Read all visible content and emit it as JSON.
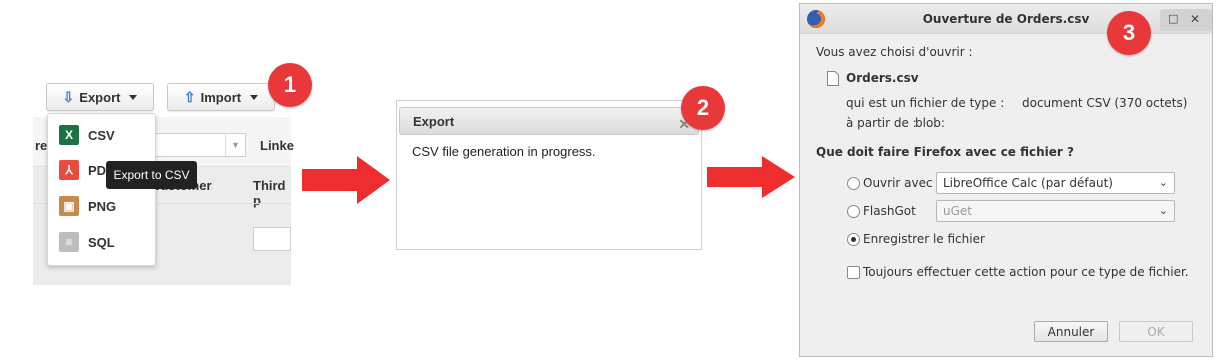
{
  "panel1": {
    "export_button": "Export",
    "import_button": "Import",
    "badge": "1",
    "bg_left_label": "re",
    "bg_linked_header": "Linke",
    "bg_customer_header": "customer",
    "bg_third_header": "Third p",
    "menu_items": [
      {
        "label": "CSV",
        "icon": "excel-icon",
        "color": "#1e7145",
        "glyph": "X"
      },
      {
        "label": "PD",
        "icon": "pdf-icon",
        "color": "#e74c3c",
        "glyph": "⅄"
      },
      {
        "label": "PNG",
        "icon": "image-icon",
        "color": "#c88a4a",
        "glyph": "▣"
      },
      {
        "label": "SQL",
        "icon": "database-icon",
        "color": "#bdbdbd",
        "glyph": "≡"
      }
    ],
    "tooltip": "Export to CSV"
  },
  "panel2": {
    "badge": "2",
    "dialog_title": "Export",
    "close_glyph": "✕",
    "message": "CSV file generation in progress."
  },
  "panel3": {
    "badge": "3",
    "window_title": "Ouverture de Orders.csv",
    "intro": "Vous avez choisi d'ouvrir :",
    "filename": "Orders.csv",
    "type_label": "qui est un fichier de type :",
    "type_value": "document CSV (370 octets)",
    "from_label": "à partir de :",
    "from_value": "blob:",
    "question": "Que doit faire Firefox avec ce fichier ?",
    "open_with_label": "Ouvrir avec",
    "open_with_value": "LibreOffice Calc (par défaut)",
    "flashgot_label": "FlashGot",
    "flashgot_value": "uGet",
    "save_label": "Enregistrer le fichier",
    "always_label": "Toujours effectuer cette action pour ce type de fichier.",
    "cancel_button": "Annuler",
    "ok_button": "OK"
  },
  "colors": {
    "badge_red": "#e8383a",
    "arrow_red": "#ee2e2e"
  }
}
